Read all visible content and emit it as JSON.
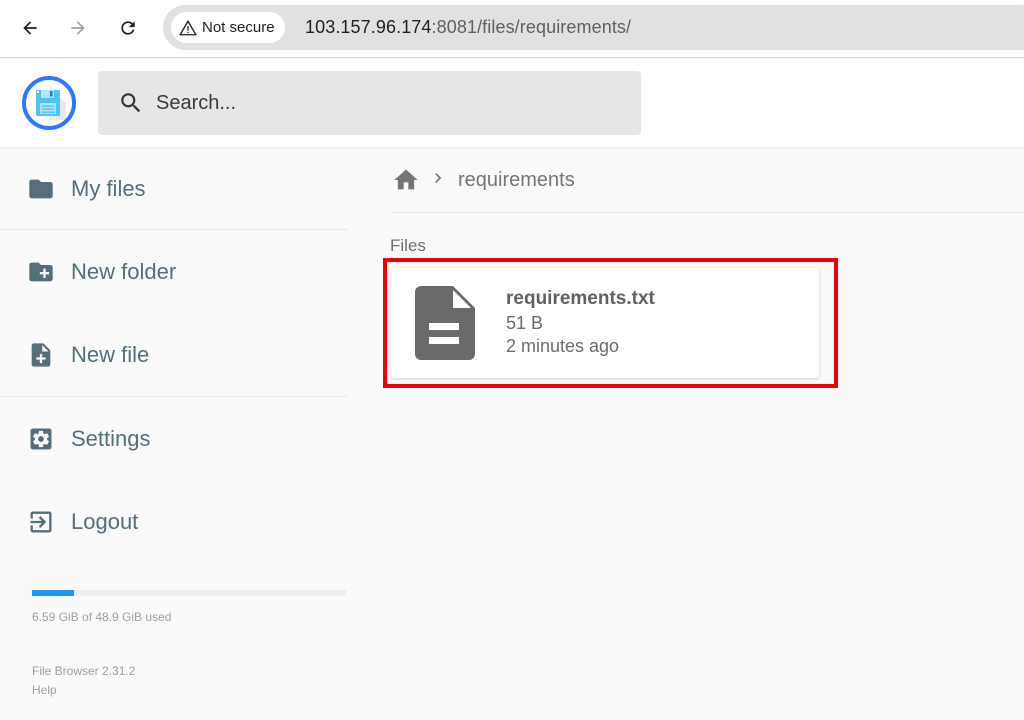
{
  "browser": {
    "security_label": "Not secure",
    "url_host": "103.157.96.174",
    "url_rest": ":8081/files/requirements/",
    "icons": {
      "back": "arrow-left",
      "forward": "arrow-right",
      "reload": "reload",
      "security": "warning-triangle"
    }
  },
  "header": {
    "logo": "floppy-disk-logo",
    "search": {
      "placeholder": "Search...",
      "value": ""
    }
  },
  "sidebar": {
    "items": [
      {
        "label": "My files",
        "icon": "folder"
      },
      {
        "label": "New folder",
        "icon": "create-new-folder"
      },
      {
        "label": "New file",
        "icon": "note-add"
      },
      {
        "label": "Settings",
        "icon": "settings-applications"
      },
      {
        "label": "Logout",
        "icon": "exit-to-app"
      }
    ],
    "quota": {
      "used_fraction": 0.135,
      "text": "6.59 GiB of 48.9 GiB used",
      "color": "#2196f3"
    },
    "footer": {
      "version": "File Browser 2.31.2",
      "help": "Help"
    }
  },
  "main": {
    "breadcrumb": {
      "home_icon": "home",
      "items": [
        "requirements"
      ]
    },
    "sections": [
      {
        "title": "Files",
        "items": [
          {
            "name": "requirements.txt",
            "size": "51 B",
            "modified": "2 minutes ago",
            "icon": "description",
            "highlighted": true
          }
        ]
      }
    ],
    "highlight_color": "#f00000"
  }
}
